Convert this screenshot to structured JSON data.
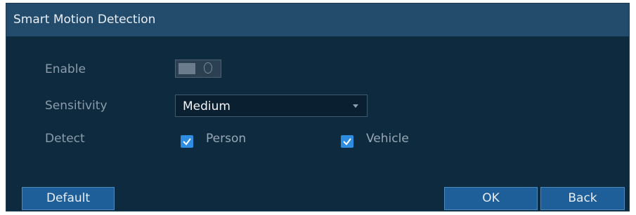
{
  "dialog": {
    "title": "Smart Motion Detection",
    "fields": {
      "enable_label": "Enable",
      "sensitivity_label": "Sensitivity",
      "sensitivity_value": "Medium",
      "detect_label": "Detect",
      "person_label": "Person",
      "vehicle_label": "Vehicle"
    },
    "enable_state": "off",
    "person_checked": true,
    "vehicle_checked": true,
    "buttons": {
      "default": "Default",
      "ok": "OK",
      "back": "Back"
    }
  },
  "colors": {
    "background": "#0e2a3f",
    "titlebar": "#234c6c",
    "accent": "#2e8de0",
    "button": "#1f5f99"
  },
  "icons": [
    "toggle-switch",
    "dropdown-caret-icon",
    "checkbox-checked-icon"
  ]
}
